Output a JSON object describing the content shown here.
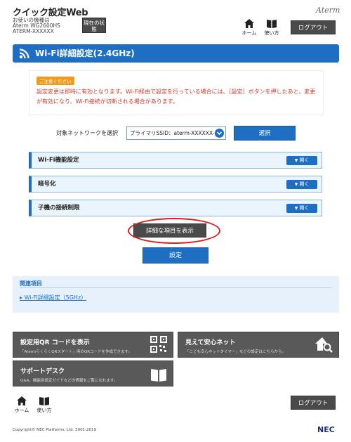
{
  "header": {
    "app_title": "クイック設定Web",
    "model_label": "お使いの機種は",
    "model_name": "Aterm WG2600HS",
    "ssid_name": "ATERM-XXXXXX",
    "status_button": "現在の状態",
    "brand": "Aterm",
    "home_label": "ホーム",
    "manual_label": "使い方",
    "logout_label": "ログアウト"
  },
  "page": {
    "title": "Wi-Fi詳細設定(2.4GHz)"
  },
  "notice": {
    "badge": "ご注意ください",
    "text": "設定変更は即時に有効となります。Wi-Fi経由で設定を行っている場合には、［設定］ボタンを押したあと、変更が有効になり、Wi-Fi接続が切断される場合があります。"
  },
  "network_select": {
    "label": "対象ネットワークを選択",
    "value": "プライマリSSID：aterm-XXXXXX-g",
    "select_button": "選択"
  },
  "accordions": [
    {
      "label": "Wi-Fi機能設定",
      "button": "開く"
    },
    {
      "label": "暗号化",
      "button": "開く"
    },
    {
      "label": "子機の接続制限",
      "button": "開く"
    }
  ],
  "buttons": {
    "show_detail": "詳細な項目を表示",
    "apply": "設定"
  },
  "related": {
    "heading": "関連項目",
    "link": "Wi-Fi詳細設定（5GHz）"
  },
  "tiles": {
    "qr": {
      "title": "設定用QR コードを表示",
      "desc": "「AtermらくらくQRスタート」用のQRコードを作成できます。"
    },
    "safe": {
      "title": "見えて安心ネット",
      "desc": "「こども安心ネットタイマー」などの設定はこちらから。"
    },
    "support": {
      "title": "サポートデスク",
      "desc": "Q&A、機能別設定ガイドなどの情報をご覧になれます。"
    }
  },
  "footer": {
    "home_label": "ホーム",
    "manual_label": "使い方",
    "logout_label": "ログアウト",
    "copyright": "Copyright© NEC Platforms, Ltd. 2001-2019",
    "logo": "NEC"
  },
  "colors": {
    "accent": "#1e6fc4",
    "dark_button": "#4a4a4a",
    "warning_text": "#d43a2a",
    "highlight_ring": "#e01b1b"
  }
}
